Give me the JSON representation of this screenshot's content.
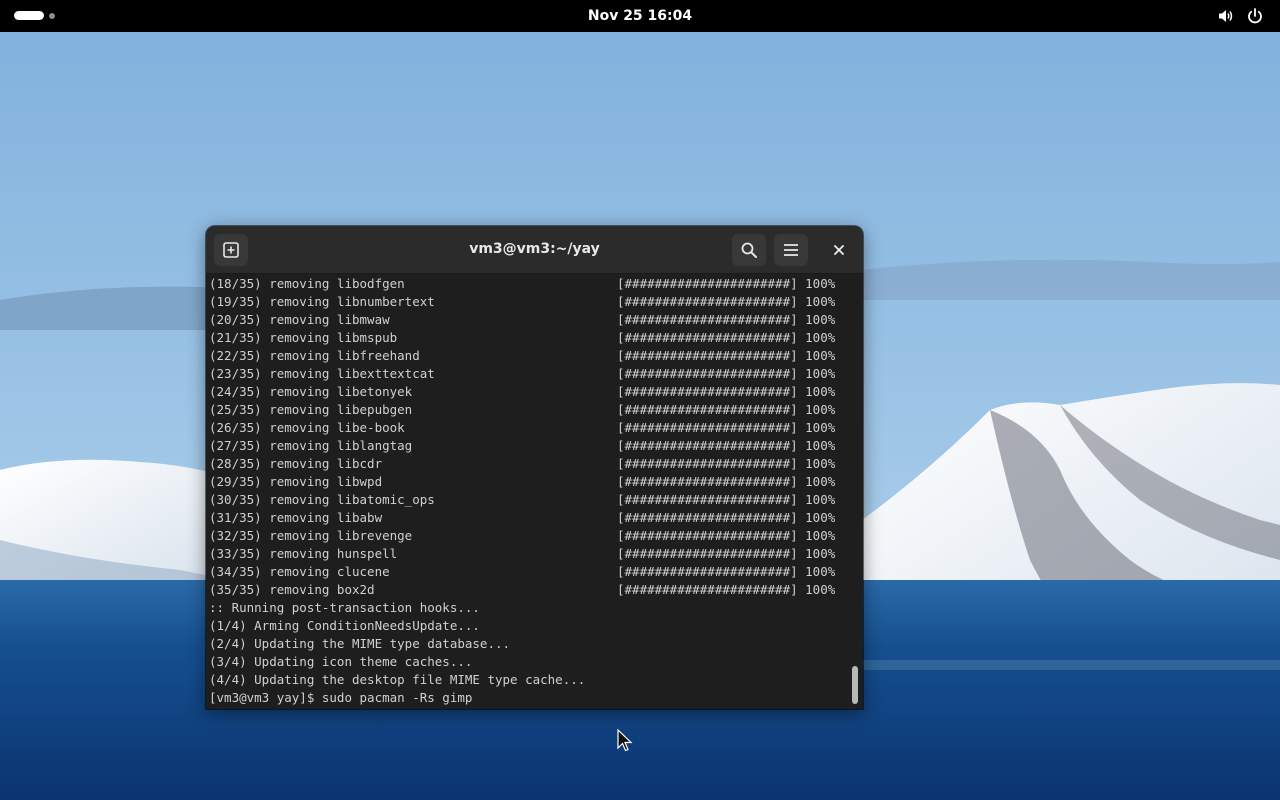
{
  "topbar": {
    "clock": "Nov 25  16:04",
    "icons": [
      "workspace-indicator",
      "volume-icon",
      "power-icon"
    ]
  },
  "terminal": {
    "title": "vm3@vm3:~/yay",
    "icons": [
      "new-tab-icon",
      "search-icon",
      "hamburger-menu-icon",
      "close-icon"
    ],
    "removing_lines": [
      {
        "text": "(18/35) removing libodfgen",
        "progress": "[######################] 100%"
      },
      {
        "text": "(19/35) removing libnumbertext",
        "progress": "[######################] 100%"
      },
      {
        "text": "(20/35) removing libmwaw",
        "progress": "[######################] 100%"
      },
      {
        "text": "(21/35) removing libmspub",
        "progress": "[######################] 100%"
      },
      {
        "text": "(22/35) removing libfreehand",
        "progress": "[######################] 100%"
      },
      {
        "text": "(23/35) removing libexttextcat",
        "progress": "[######################] 100%"
      },
      {
        "text": "(24/35) removing libetonyek",
        "progress": "[######################] 100%"
      },
      {
        "text": "(25/35) removing libepubgen",
        "progress": "[######################] 100%"
      },
      {
        "text": "(26/35) removing libe-book",
        "progress": "[######################] 100%"
      },
      {
        "text": "(27/35) removing liblangtag",
        "progress": "[######################] 100%"
      },
      {
        "text": "(28/35) removing libcdr",
        "progress": "[######################] 100%"
      },
      {
        "text": "(29/35) removing libwpd",
        "progress": "[######################] 100%"
      },
      {
        "text": "(30/35) removing libatomic_ops",
        "progress": "[######################] 100%"
      },
      {
        "text": "(31/35) removing libabw",
        "progress": "[######################] 100%"
      },
      {
        "text": "(32/35) removing librevenge",
        "progress": "[######################] 100%"
      },
      {
        "text": "(33/35) removing hunspell",
        "progress": "[######################] 100%"
      },
      {
        "text": "(34/35) removing clucene",
        "progress": "[######################] 100%"
      },
      {
        "text": "(35/35) removing box2d",
        "progress": "[######################] 100%"
      }
    ],
    "hook_lines": [
      ":: Running post-transaction hooks...",
      "(1/4) Arming ConditionNeedsUpdate...",
      "(2/4) Updating the MIME type database...",
      "(3/4) Updating icon theme caches...",
      "(4/4) Updating the desktop file MIME type cache..."
    ],
    "prompt_line": "[vm3@vm3 yay]$ sudo pacman -Rs gimp"
  }
}
